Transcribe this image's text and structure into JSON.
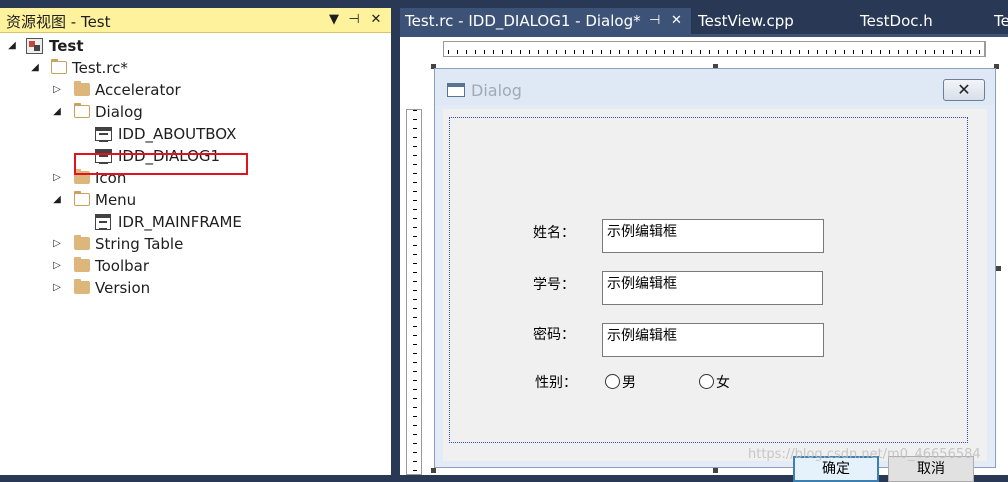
{
  "resource_view": {
    "title": "资源视图 - Test",
    "buttons": {
      "dropdown": "▼",
      "pin": "⊣",
      "close": "✕"
    },
    "tree": {
      "project": {
        "label": "Test",
        "expander": "◢"
      },
      "rc_file": {
        "label": "Test.rc*",
        "expander": "◢"
      },
      "accelerator": {
        "label": "Accelerator",
        "expander": "▷"
      },
      "dialog_folder": {
        "label": "Dialog",
        "expander": "◢"
      },
      "aboutbox": {
        "label": "IDD_ABOUTBOX"
      },
      "dialog1": {
        "label": "IDD_DIALOG1"
      },
      "icon_folder": {
        "label": "Icon",
        "expander": "▷"
      },
      "menu_folder": {
        "label": "Menu",
        "expander": "◢"
      },
      "mainframe": {
        "label": "IDR_MAINFRAME"
      },
      "string_table": {
        "label": "String Table",
        "expander": "▷"
      },
      "toolbar": {
        "label": "Toolbar",
        "expander": "▷"
      },
      "version": {
        "label": "Version",
        "expander": "▷"
      }
    }
  },
  "tabs": [
    {
      "label": "Test.rc - IDD_DIALOG1 - Dialog*",
      "active": true,
      "pin": "⊣",
      "close": "✕"
    },
    {
      "label": "TestView.cpp"
    },
    {
      "label": "TestDoc.h"
    },
    {
      "label": "Te"
    }
  ],
  "dialog": {
    "caption": "Dialog",
    "close_glyph": "✕",
    "fields": [
      {
        "label": "姓名：",
        "value": "示例编辑框"
      },
      {
        "label": "学号：",
        "value": "示例编辑框"
      },
      {
        "label": "密码：",
        "value": "示例编辑框"
      }
    ],
    "gender": {
      "label": "性别：",
      "options": [
        "男",
        "女"
      ]
    },
    "buttons": {
      "ok": "确定",
      "cancel": "取消"
    }
  },
  "watermark": "https://blog.csdn.net/m0_46656584",
  "colors": {
    "title_bar": "#fff29d",
    "ide_background": "#293955",
    "active_tab": "#3d5277",
    "selection_highlight": "#e0141e"
  }
}
